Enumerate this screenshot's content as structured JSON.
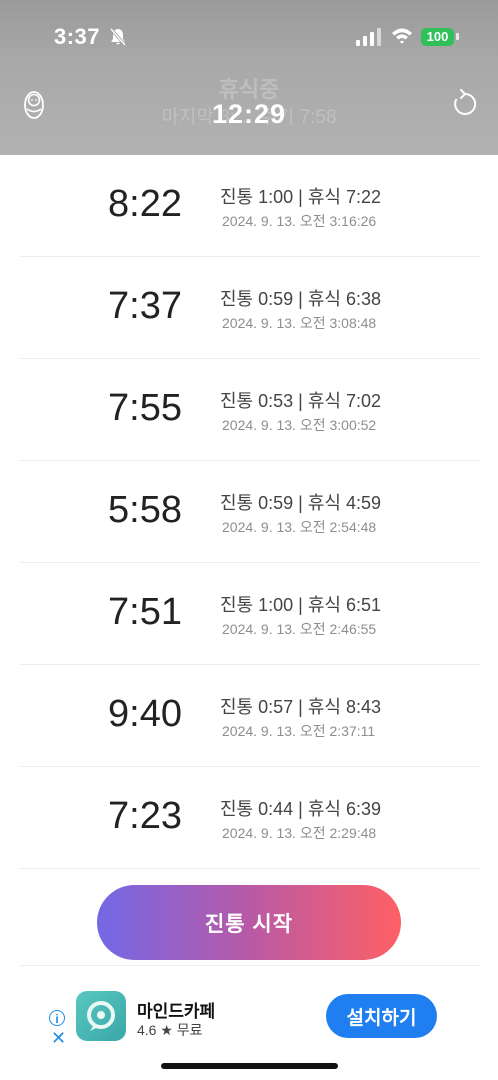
{
  "status_bar": {
    "time": "3:37",
    "battery": "100"
  },
  "header": {
    "resting_label": "휴식중",
    "last_interval": "마지막 3:… 주기 7:58",
    "timer": "12:29"
  },
  "records": [
    {
      "interval": "8:22",
      "detail": "진통 1:00 | 휴식 7:22",
      "timestamp": "2024. 9. 13. 오전 3:16:26"
    },
    {
      "interval": "7:37",
      "detail": "진통 0:59 | 휴식 6:38",
      "timestamp": "2024. 9. 13. 오전 3:08:48"
    },
    {
      "interval": "7:55",
      "detail": "진통 0:53 | 휴식 7:02",
      "timestamp": "2024. 9. 13. 오전 3:00:52"
    },
    {
      "interval": "5:58",
      "detail": "진통 0:59 | 휴식 4:59",
      "timestamp": "2024. 9. 13. 오전 2:54:48"
    },
    {
      "interval": "7:51",
      "detail": "진통 1:00 | 휴식 6:51",
      "timestamp": "2024. 9. 13. 오전 2:46:55"
    },
    {
      "interval": "9:40",
      "detail": "진통 0:57 | 휴식 8:43",
      "timestamp": "2024. 9. 13. 오전 2:37:11"
    },
    {
      "interval": "7:23",
      "detail": "진통 0:44 | 휴식 6:39",
      "timestamp": "2024. 9. 13. 오전 2:29:48"
    }
  ],
  "start_button": {
    "label": "진통 시작"
  },
  "ad": {
    "app_name": "마인드카페",
    "rating": "4.6 ★ 무료",
    "install_label": "설치하기",
    "info_glyph": "i",
    "close_glyph": "✕"
  },
  "icons": {
    "bell_off": "bell-off-icon",
    "signal": "signal-icon",
    "wifi": "wifi-icon",
    "baby": "baby-icon",
    "refresh": "refresh-icon"
  },
  "colors": {
    "gradient_start": "#7468e6",
    "gradient_end": "#ff6065",
    "install_blue": "#1f7ff0",
    "battery_green": "#30c05a"
  }
}
